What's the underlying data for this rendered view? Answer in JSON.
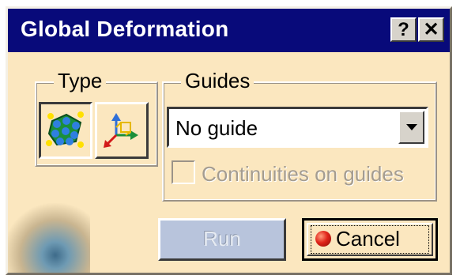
{
  "window": {
    "title": "Global Deformation"
  },
  "titlebar": {
    "help_label": "?",
    "close_label": "✕"
  },
  "type": {
    "legend": "Type",
    "options": [
      {
        "icon": "surface-mesh-icon",
        "pressed": true
      },
      {
        "icon": "axis-system-icon",
        "pressed": false
      }
    ]
  },
  "guides": {
    "legend": "Guides",
    "select": {
      "value": "No guide"
    },
    "continuities": {
      "label": "Continuities on guides",
      "checked": false,
      "enabled": false
    }
  },
  "buttons": {
    "run_label": "Run",
    "cancel_label": "Cancel"
  },
  "colors": {
    "titlebar": "#080a7a",
    "dialog_bg": "#fbe7bf",
    "run_button_bg": "#b8c4dc",
    "cancel_icon": "#e0241a"
  }
}
